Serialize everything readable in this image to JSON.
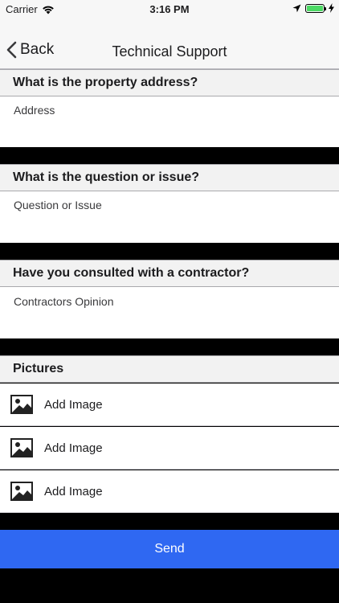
{
  "status_bar": {
    "carrier": "Carrier",
    "time": "3:16 PM"
  },
  "nav": {
    "back_label": "Back",
    "title": "Technical Support"
  },
  "sections": {
    "address": {
      "header": "What is the property address?",
      "placeholder": "Address"
    },
    "question": {
      "header": "What is the question or issue?",
      "placeholder": "Question or Issue"
    },
    "contractor": {
      "header": "Have you consulted with a contractor?",
      "placeholder": "Contractors Opinion"
    },
    "pictures": {
      "header": "Pictures",
      "items": [
        {
          "label": "Add Image",
          "icon": "image-icon"
        },
        {
          "label": "Add Image",
          "icon": "image-icon"
        },
        {
          "label": "Add Image",
          "icon": "image-icon"
        }
      ]
    }
  },
  "send_label": "Send",
  "colors": {
    "send_button": "#2f68f2",
    "background": "#000000",
    "header_bg": "#f2f2f2"
  }
}
